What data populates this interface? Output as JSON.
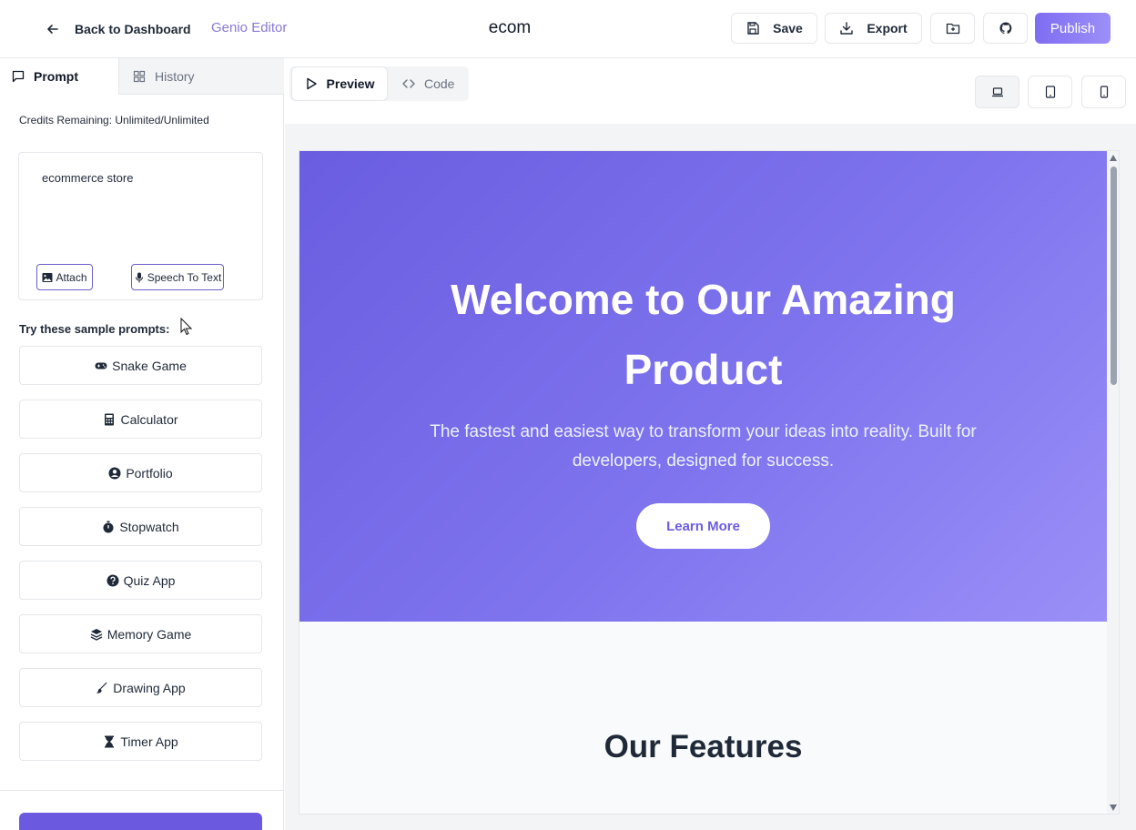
{
  "header": {
    "back_label": "Back to Dashboard",
    "brand": "Genio Editor",
    "project_name": "ecom",
    "save_label": "Save",
    "export_label": "Export",
    "publish_label": "Publish",
    "accent_color": "#7f6df2"
  },
  "sidebar": {
    "tabs": [
      {
        "label": "Prompt",
        "icon": "message-square-icon",
        "active": true
      },
      {
        "label": "History",
        "icon": "grid-icon",
        "active": false
      }
    ],
    "credits": "Credits Remaining: Unlimited/Unlimited",
    "prompt_text": "ecommerce store",
    "attach_label": "Attach",
    "speech_label": "Speech To Text",
    "samples_title": "Try these sample prompts:",
    "samples": [
      {
        "label": "Snake Game",
        "icon": "gamepad-icon"
      },
      {
        "label": "Calculator",
        "icon": "calculator-icon"
      },
      {
        "label": "Portfolio",
        "icon": "user-circle-icon"
      },
      {
        "label": "Stopwatch",
        "icon": "stopwatch-icon"
      },
      {
        "label": "Quiz App",
        "icon": "question-circle-icon"
      },
      {
        "label": "Memory Game",
        "icon": "layers-icon"
      },
      {
        "label": "Drawing App",
        "icon": "paintbrush-icon"
      },
      {
        "label": "Timer App",
        "icon": "hourglass-icon"
      }
    ]
  },
  "main": {
    "tabs": [
      {
        "label": "Preview",
        "icon": "play-icon",
        "active": true
      },
      {
        "label": "Code",
        "icon": "code-icon",
        "active": false
      }
    ],
    "devices": [
      "laptop-icon",
      "tablet-icon",
      "phone-icon"
    ]
  },
  "preview": {
    "hero_title": "Welcome to Our Amazing Product",
    "hero_subtitle": "The fastest and easiest way to transform your ideas into reality. Built for developers, designed for success.",
    "cta_label": "Learn More",
    "features_title": "Our Features",
    "hero_gradient_start": "#6a5de0",
    "hero_gradient_end": "#9a8ff7"
  }
}
